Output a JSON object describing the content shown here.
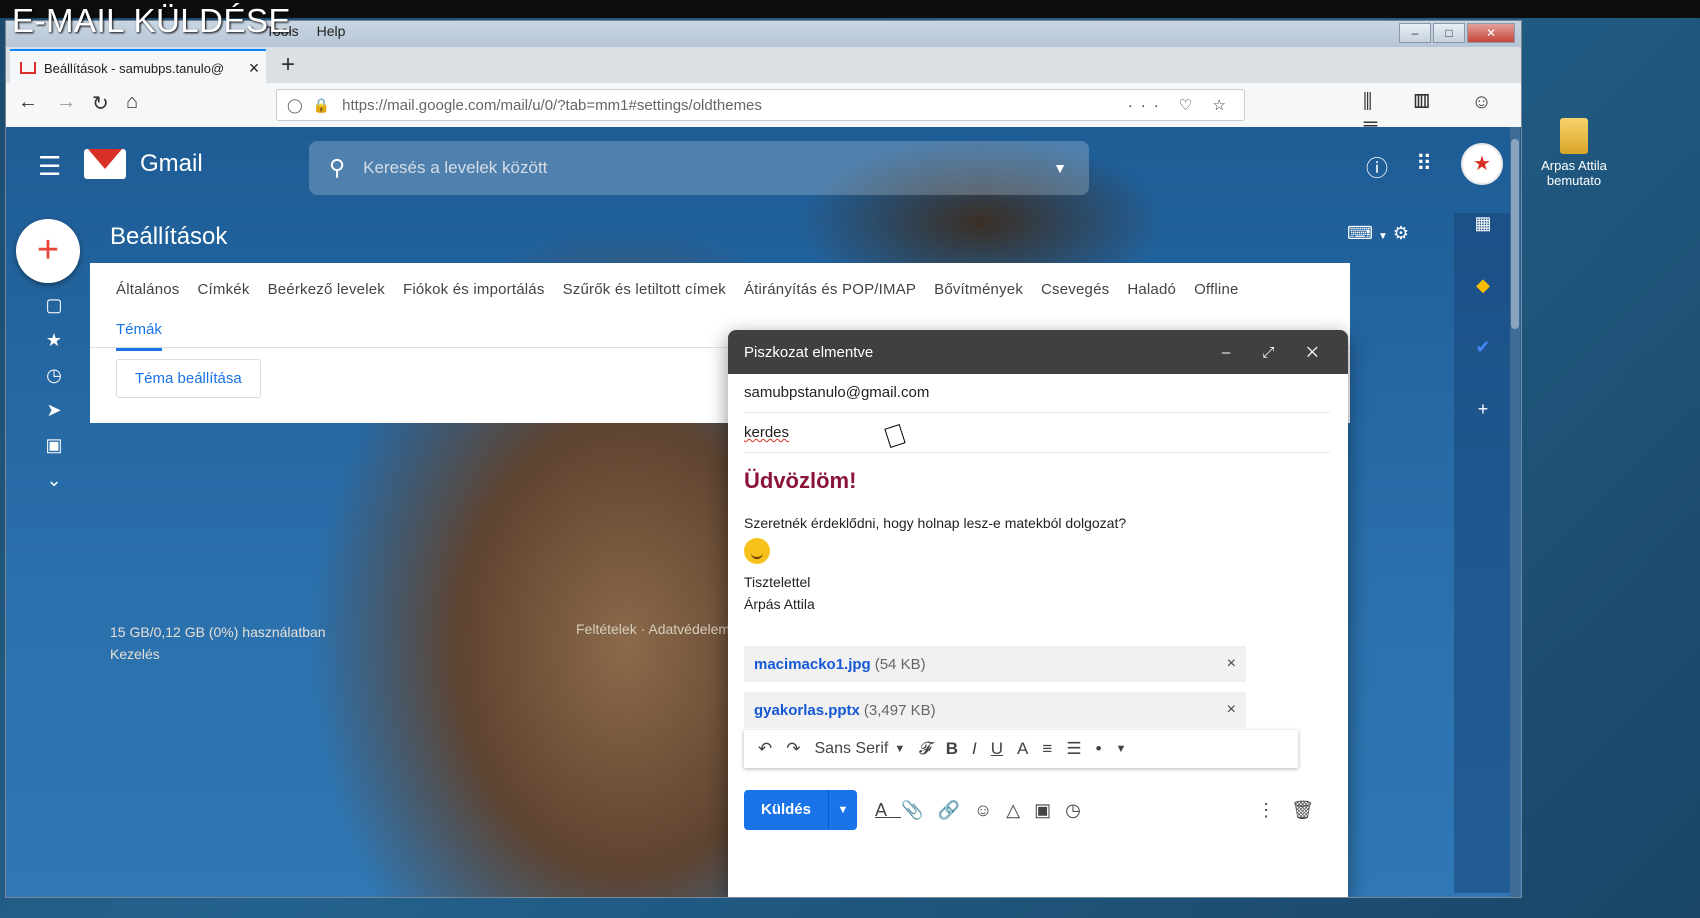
{
  "overlay": {
    "video_title": "E-MAIL KÜLDÉSE"
  },
  "desktop": {
    "icon_label_line1": "Arpas Attila",
    "icon_label_line2": "bemutato"
  },
  "browser": {
    "menu": [
      "Tools",
      "Help"
    ],
    "tab_title": "Beállítások - samubps.tanulo@",
    "tab_close": "×",
    "new_tab": "+",
    "url": "https://mail.google.com/mail/u/0/?tab=mm1#settings/oldthemes",
    "url_actions": "··· ♡ ☆",
    "nav_right": "⫼ ▥ ☺ ☰",
    "window_controls": [
      "–",
      "□",
      "✕"
    ]
  },
  "gmail": {
    "logo_text": "Gmail",
    "search_placeholder": "Keresés a levelek között",
    "page_title": "Beállítások",
    "settings_tabs": [
      "Általános",
      "Címkék",
      "Beérkező levelek",
      "Fiókok és importálás",
      "Szűrők és letiltott címek",
      "Átirányítás és POP/IMAP",
      "Bővítmények",
      "Csevegés",
      "Haladó",
      "Offline"
    ],
    "active_tab": "Témák",
    "theme_button": "Téma beállítása",
    "storage_line": "15 GB/0,12 GB (0%) használatban",
    "manage_link": "Kezelés",
    "footer_links": "Feltételek · Adatvédelem"
  },
  "compose": {
    "header": "Piszkozat elmentve",
    "header_controls": "– ⤢ ✕",
    "to": "samubpstanulo@gmail.com",
    "subject": "kerdes",
    "greeting": "Üdvözlöm!",
    "body_line1": "Szeretnék érdeklődni, hogy holnap lesz-e matekból dolgozat?",
    "closing": "Tisztelettel",
    "signature": "Árpás Attila",
    "attachments": [
      {
        "name": "macimacko1.jpg",
        "size": "(54 KB)"
      },
      {
        "name": "gyakorlas.pptx",
        "size": "(3,497 KB)"
      }
    ],
    "remove": "×",
    "font_name": "Sans Serif",
    "send_label": "Küldés"
  }
}
